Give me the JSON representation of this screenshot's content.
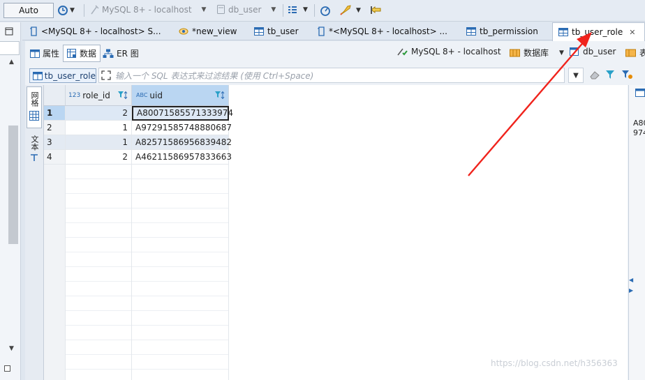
{
  "toolbar": {
    "auto_combo": "Auto",
    "connection": "MySQL 8+ - localhost",
    "database": "db_user"
  },
  "tabs": [
    {
      "label": "<MySQL 8+ - localhost> S..."
    },
    {
      "label": "*new_view"
    },
    {
      "label": "tb_user"
    },
    {
      "label": "*<MySQL 8+ - localhost> ..."
    },
    {
      "label": "tb_permission"
    },
    {
      "label": "tb_user_role",
      "active": true
    }
  ],
  "subtabs": {
    "properties": "属性",
    "data": "数据",
    "er": "ER 图"
  },
  "breadcrumb": {
    "connection": "MySQL 8+ - localhost",
    "database_label": "数据库",
    "database": "db_user",
    "table_label": "表"
  },
  "filter": {
    "table_name": "tb_user_role",
    "placeholder": "输入一个 SQL 表达式来过滤结果 (使用 Ctrl+Space)"
  },
  "side_tabs": {
    "grid": "网格",
    "text": "文本"
  },
  "grid": {
    "columns": [
      {
        "name": "role_id",
        "type_badge": "123"
      },
      {
        "name": "uid",
        "type_badge": "ABC"
      }
    ],
    "rows": [
      {
        "n": "1",
        "role_id": "2",
        "uid": "A80071585571333974"
      },
      {
        "n": "2",
        "role_id": "1",
        "uid": "A97291585748880687"
      },
      {
        "n": "3",
        "role_id": "1",
        "uid": "A82571586956839482"
      },
      {
        "n": "4",
        "role_id": "2",
        "uid": "A46211586957833663"
      }
    ]
  },
  "right_panel": {
    "line1": "A80",
    "line2": "974"
  },
  "watermark": "https://blog.csdn.net/h356363",
  "colors": {
    "accent_red": "#f0231c",
    "selection": "#cfe1f5",
    "header_selected": "#bad6f2"
  }
}
